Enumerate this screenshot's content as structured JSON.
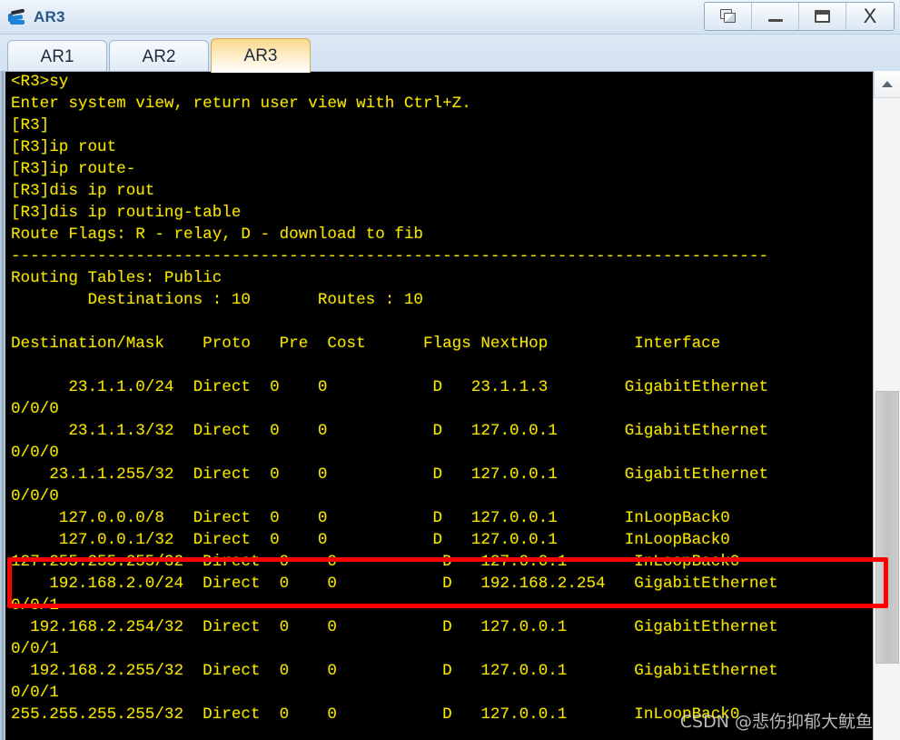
{
  "window": {
    "title": "AR3",
    "icon": "router-icon",
    "buttons": [
      {
        "name": "restore-window-button",
        "icon": "restore-icon",
        "label": ""
      },
      {
        "name": "minimize-button",
        "icon": "minimize-icon",
        "label": ""
      },
      {
        "name": "maximize-button",
        "icon": "maximize-icon",
        "label": ""
      },
      {
        "name": "close-button",
        "icon": "close-icon",
        "label": "X"
      }
    ]
  },
  "tabs": [
    {
      "label": "AR1",
      "active": false
    },
    {
      "label": "AR2",
      "active": false
    },
    {
      "label": "AR3",
      "active": true
    }
  ],
  "terminal": {
    "foreground_color": "#f5e400",
    "background_color": "#000000",
    "lines": [
      "<R3>sy",
      "Enter system view, return user view with Ctrl+Z.",
      "[R3]",
      "[R3]ip rout",
      "[R3]ip route-",
      "[R3]dis ip rout",
      "[R3]dis ip routing-table",
      "Route Flags: R - relay, D - download to fib",
      "-------------------------------------------------------------------------------",
      "Routing Tables: Public",
      "        Destinations : 10       Routes : 10",
      "",
      "Destination/Mask    Proto   Pre  Cost      Flags NextHop         Interface",
      "",
      "      23.1.1.0/24  Direct  0    0           D   23.1.1.3        GigabitEthernet",
      "0/0/0",
      "      23.1.1.3/32  Direct  0    0           D   127.0.0.1       GigabitEthernet",
      "0/0/0",
      "    23.1.1.255/32  Direct  0    0           D   127.0.0.1       GigabitEthernet",
      "0/0/0",
      "     127.0.0.0/8   Direct  0    0           D   127.0.0.1       InLoopBack0",
      "     127.0.0.1/32  Direct  0    0           D   127.0.0.1       InLoopBack0",
      "127.255.255.255/32  Direct  0    0           D   127.0.0.1       InLoopBack0",
      "    192.168.2.0/24  Direct  0    0           D   192.168.2.254   GigabitEthernet",
      "0/0/1",
      "  192.168.2.254/32  Direct  0    0           D   127.0.0.1       GigabitEthernet",
      "0/0/1",
      "  192.168.2.255/32  Direct  0    0           D   127.0.0.1       GigabitEthernet",
      "0/0/1",
      "255.255.255.255/32  Direct  0    0           D   127.0.0.1       InLoopBack0"
    ],
    "routing_table": {
      "flags_legend": "Route Flags: R - relay, D - download to fib",
      "table_name": "Routing Tables: Public",
      "destinations": "10",
      "routes": "10",
      "columns": [
        "Destination/Mask",
        "Proto",
        "Pre",
        "Cost",
        "Flags",
        "NextHop",
        "Interface"
      ],
      "rows": [
        {
          "dest": "23.1.1.0/24",
          "proto": "Direct",
          "pre": "0",
          "cost": "0",
          "flags": "D",
          "nexthop": "23.1.1.3",
          "interface": "GigabitEthernet0/0/0"
        },
        {
          "dest": "23.1.1.3/32",
          "proto": "Direct",
          "pre": "0",
          "cost": "0",
          "flags": "D",
          "nexthop": "127.0.0.1",
          "interface": "GigabitEthernet0/0/0"
        },
        {
          "dest": "23.1.1.255/32",
          "proto": "Direct",
          "pre": "0",
          "cost": "0",
          "flags": "D",
          "nexthop": "127.0.0.1",
          "interface": "GigabitEthernet0/0/0"
        },
        {
          "dest": "127.0.0.0/8",
          "proto": "Direct",
          "pre": "0",
          "cost": "0",
          "flags": "D",
          "nexthop": "127.0.0.1",
          "interface": "InLoopBack0"
        },
        {
          "dest": "127.0.0.1/32",
          "proto": "Direct",
          "pre": "0",
          "cost": "0",
          "flags": "D",
          "nexthop": "127.0.0.1",
          "interface": "InLoopBack0"
        },
        {
          "dest": "127.255.255.255/32",
          "proto": "Direct",
          "pre": "0",
          "cost": "0",
          "flags": "D",
          "nexthop": "127.0.0.1",
          "interface": "InLoopBack0"
        },
        {
          "dest": "192.168.2.0/24",
          "proto": "Direct",
          "pre": "0",
          "cost": "0",
          "flags": "D",
          "nexthop": "192.168.2.254",
          "interface": "GigabitEthernet0/0/1",
          "highlighted": true
        },
        {
          "dest": "192.168.2.254/32",
          "proto": "Direct",
          "pre": "0",
          "cost": "0",
          "flags": "D",
          "nexthop": "127.0.0.1",
          "interface": "GigabitEthernet0/0/1"
        },
        {
          "dest": "192.168.2.255/32",
          "proto": "Direct",
          "pre": "0",
          "cost": "0",
          "flags": "D",
          "nexthop": "127.0.0.1",
          "interface": "GigabitEthernet0/0/1"
        },
        {
          "dest": "255.255.255.255/32",
          "proto": "Direct",
          "pre": "0",
          "cost": "0",
          "flags": "D",
          "nexthop": "127.0.0.1",
          "interface": "InLoopBack0"
        }
      ]
    }
  },
  "annotation": {
    "color": "#ff0000",
    "shape": "rectangle",
    "target_row": "192.168.2.0/24"
  },
  "scrollbar": {
    "up_arrow": "chevron-up-icon",
    "orientation": "vertical"
  },
  "watermark": {
    "text": "CSDN @悲伤抑郁大鱿鱼"
  }
}
